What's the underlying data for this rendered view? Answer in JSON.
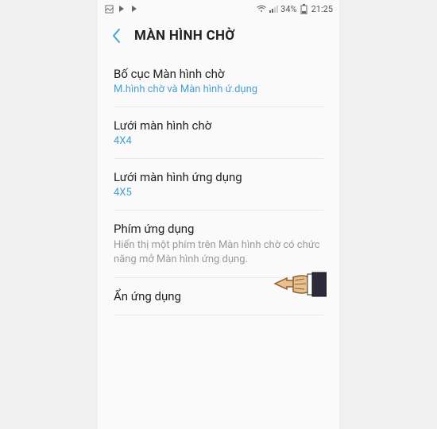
{
  "statusBar": {
    "battery": "34%",
    "time": "21:25"
  },
  "header": {
    "title": "MÀN HÌNH CHỜ"
  },
  "items": [
    {
      "title": "Bố cục Màn hình chờ",
      "value": "M.hình chờ và Màn hình ứ.dụng"
    },
    {
      "title": "Lưới màn hình chờ",
      "value": "4X4"
    },
    {
      "title": "Lưới màn hình ứng dụng",
      "value": "4X5"
    },
    {
      "title": "Phím ứng dụng",
      "desc": "Hiển thị một phím trên Màn hình chờ có chức năng mở Màn hình ứng dụng."
    },
    {
      "title": "Ẩn ứng dụng"
    }
  ]
}
